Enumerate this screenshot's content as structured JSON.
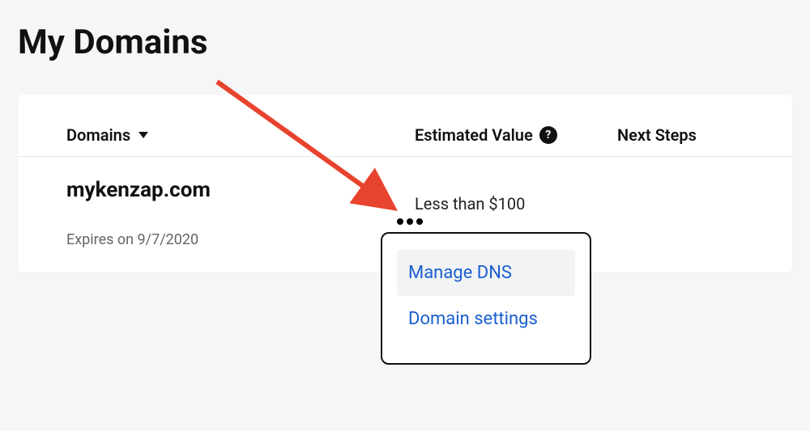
{
  "page": {
    "title": "My Domains"
  },
  "table": {
    "headers": {
      "domains": "Domains",
      "estimated_value": "Estimated Value",
      "next_steps": "Next Steps"
    },
    "row": {
      "domain": "mykenzap.com",
      "expires": "Expires on 9/7/2020",
      "estimated_value": "Less than $100"
    }
  },
  "menu": {
    "items": [
      {
        "label": "Manage DNS",
        "hover": true
      },
      {
        "label": "Domain settings",
        "hover": false
      }
    ]
  },
  "annotation": {
    "arrow_color": "#e8432e"
  }
}
